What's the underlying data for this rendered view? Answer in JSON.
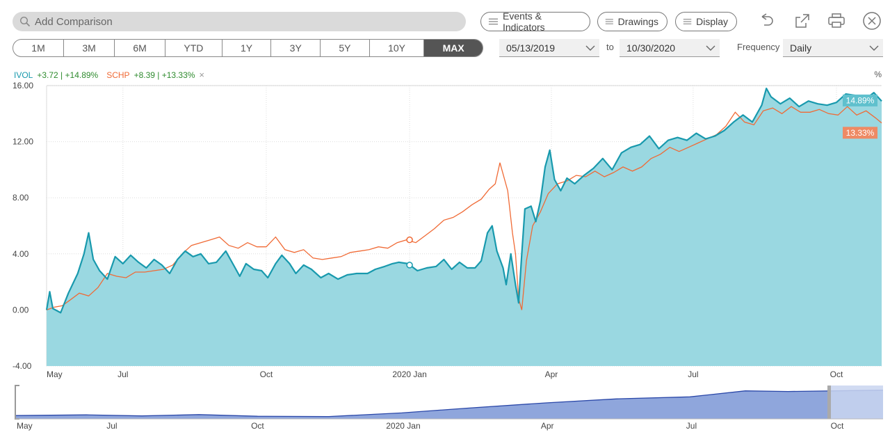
{
  "search": {
    "placeholder": "Add Comparison"
  },
  "toolbar": {
    "events_label": "Events & Indicators",
    "drawings_label": "Drawings",
    "display_label": "Display"
  },
  "ranges": [
    "1M",
    "3M",
    "6M",
    "YTD",
    "1Y",
    "3Y",
    "5Y",
    "10Y",
    "MAX"
  ],
  "range_selected": "MAX",
  "dates": {
    "from": "05/13/2019",
    "to_label": "to",
    "to": "10/30/2020"
  },
  "frequency": {
    "label": "Frequency",
    "value": "Daily"
  },
  "legend": {
    "ivol_name": "IVOL",
    "ivol_stats": "+3.72 | +14.89%",
    "schp_name": "SCHP",
    "schp_stats": "+8.39 | +13.33%",
    "close_glyph": "×",
    "unit": "%"
  },
  "colors": {
    "ivol": "#1899ad",
    "ivol_fill": "#9ad8e1",
    "schp": "#f06a35",
    "gain": "#2e8b2e",
    "navigator": "#8fa6dc",
    "navigator_line": "#2a47a8"
  },
  "chart_data": {
    "type": "line",
    "x_start": "2019-05-13",
    "x_end": "2020-10-30",
    "ylim": [
      -4,
      16
    ],
    "yticks": [
      16,
      12,
      8,
      4,
      0,
      -4
    ],
    "ytick_labels": [
      "16.00",
      "12.00",
      "8.00",
      "4.00",
      "0.00",
      "-4.00"
    ],
    "xtick_dates": [
      "2019-05-01",
      "2019-07-01",
      "2019-10-01",
      "2020-01-01",
      "2020-04-01",
      "2020-07-01",
      "2020-10-01"
    ],
    "xtick_labels": [
      "May",
      "Jul",
      "Oct",
      "2020 Jan",
      "Apr",
      "Jul",
      "Oct"
    ],
    "series": [
      {
        "name": "IVOL",
        "end_label": "14.89%",
        "points": [
          [
            "2019-05-13",
            0.0
          ],
          [
            "2019-05-15",
            1.3
          ],
          [
            "2019-05-17",
            0.1
          ],
          [
            "2019-05-22",
            -0.2
          ],
          [
            "2019-05-27",
            1.2
          ],
          [
            "2019-06-02",
            2.6
          ],
          [
            "2019-06-06",
            4.0
          ],
          [
            "2019-06-09",
            5.5
          ],
          [
            "2019-06-12",
            3.6
          ],
          [
            "2019-06-16",
            2.8
          ],
          [
            "2019-06-21",
            2.2
          ],
          [
            "2019-06-26",
            3.8
          ],
          [
            "2019-07-01",
            3.3
          ],
          [
            "2019-07-06",
            3.9
          ],
          [
            "2019-07-11",
            3.4
          ],
          [
            "2019-07-16",
            3.0
          ],
          [
            "2019-07-21",
            3.6
          ],
          [
            "2019-07-26",
            3.2
          ],
          [
            "2019-07-31",
            2.6
          ],
          [
            "2019-08-05",
            3.6
          ],
          [
            "2019-08-10",
            4.2
          ],
          [
            "2019-08-15",
            3.8
          ],
          [
            "2019-08-20",
            4.0
          ],
          [
            "2019-08-25",
            3.3
          ],
          [
            "2019-08-30",
            3.4
          ],
          [
            "2019-09-05",
            4.2
          ],
          [
            "2019-09-10",
            3.2
          ],
          [
            "2019-09-14",
            2.4
          ],
          [
            "2019-09-18",
            3.3
          ],
          [
            "2019-09-23",
            2.9
          ],
          [
            "2019-09-28",
            2.8
          ],
          [
            "2019-10-02",
            2.3
          ],
          [
            "2019-10-07",
            3.3
          ],
          [
            "2019-10-11",
            3.9
          ],
          [
            "2019-10-16",
            3.3
          ],
          [
            "2019-10-20",
            2.6
          ],
          [
            "2019-10-25",
            3.2
          ],
          [
            "2019-10-30",
            2.9
          ],
          [
            "2019-11-05",
            2.3
          ],
          [
            "2019-11-10",
            2.6
          ],
          [
            "2019-11-16",
            2.2
          ],
          [
            "2019-11-22",
            2.5
          ],
          [
            "2019-11-28",
            2.6
          ],
          [
            "2019-12-05",
            2.6
          ],
          [
            "2019-12-10",
            2.9
          ],
          [
            "2019-12-16",
            3.1
          ],
          [
            "2019-12-21",
            3.3
          ],
          [
            "2019-12-25",
            3.4
          ],
          [
            "2019-12-31",
            3.3
          ],
          [
            "2020-01-06",
            2.8
          ],
          [
            "2020-01-12",
            3.0
          ],
          [
            "2020-01-18",
            3.1
          ],
          [
            "2020-01-23",
            3.6
          ],
          [
            "2020-01-28",
            2.9
          ],
          [
            "2020-02-02",
            3.4
          ],
          [
            "2020-02-07",
            3.0
          ],
          [
            "2020-02-12",
            3.0
          ],
          [
            "2020-02-16",
            3.5
          ],
          [
            "2020-02-20",
            5.5
          ],
          [
            "2020-02-23",
            6.0
          ],
          [
            "2020-02-26",
            4.2
          ],
          [
            "2020-03-01",
            3.0
          ],
          [
            "2020-03-03",
            1.8
          ],
          [
            "2020-03-06",
            4.0
          ],
          [
            "2020-03-09",
            1.8
          ],
          [
            "2020-03-11",
            0.5
          ],
          [
            "2020-03-13",
            4.0
          ],
          [
            "2020-03-15",
            7.2
          ],
          [
            "2020-03-19",
            7.4
          ],
          [
            "2020-03-22",
            6.3
          ],
          [
            "2020-03-25",
            7.8
          ],
          [
            "2020-03-28",
            10.2
          ],
          [
            "2020-03-31",
            11.4
          ],
          [
            "2020-04-03",
            9.3
          ],
          [
            "2020-04-07",
            8.5
          ],
          [
            "2020-04-11",
            9.4
          ],
          [
            "2020-04-16",
            9.0
          ],
          [
            "2020-04-22",
            9.6
          ],
          [
            "2020-04-28",
            10.1
          ],
          [
            "2020-05-04",
            10.8
          ],
          [
            "2020-05-10",
            10.0
          ],
          [
            "2020-05-16",
            11.2
          ],
          [
            "2020-05-22",
            11.6
          ],
          [
            "2020-05-28",
            11.8
          ],
          [
            "2020-06-03",
            12.4
          ],
          [
            "2020-06-09",
            11.5
          ],
          [
            "2020-06-15",
            12.1
          ],
          [
            "2020-06-21",
            12.3
          ],
          [
            "2020-06-27",
            12.1
          ],
          [
            "2020-07-03",
            12.6
          ],
          [
            "2020-07-09",
            12.2
          ],
          [
            "2020-07-15",
            12.4
          ],
          [
            "2020-07-21",
            12.8
          ],
          [
            "2020-07-27",
            13.4
          ],
          [
            "2020-08-02",
            13.9
          ],
          [
            "2020-08-08",
            13.4
          ],
          [
            "2020-08-14",
            14.6
          ],
          [
            "2020-08-17",
            15.8
          ],
          [
            "2020-08-20",
            15.2
          ],
          [
            "2020-08-26",
            14.7
          ],
          [
            "2020-09-01",
            15.1
          ],
          [
            "2020-09-07",
            14.5
          ],
          [
            "2020-09-13",
            14.9
          ],
          [
            "2020-09-19",
            14.7
          ],
          [
            "2020-09-25",
            14.6
          ],
          [
            "2020-10-01",
            14.8
          ],
          [
            "2020-10-07",
            15.4
          ],
          [
            "2020-10-13",
            15.3
          ],
          [
            "2020-10-19",
            15.0
          ],
          [
            "2020-10-25",
            15.5
          ],
          [
            "2020-10-30",
            14.89
          ]
        ]
      },
      {
        "name": "SCHP",
        "end_label": "13.33%",
        "points": [
          [
            "2019-05-13",
            0.0
          ],
          [
            "2019-05-18",
            0.2
          ],
          [
            "2019-05-23",
            0.3
          ],
          [
            "2019-05-28",
            0.7
          ],
          [
            "2019-06-03",
            1.2
          ],
          [
            "2019-06-09",
            1.0
          ],
          [
            "2019-06-15",
            1.6
          ],
          [
            "2019-06-21",
            2.6
          ],
          [
            "2019-06-27",
            2.4
          ],
          [
            "2019-07-03",
            2.3
          ],
          [
            "2019-07-09",
            2.7
          ],
          [
            "2019-07-15",
            2.7
          ],
          [
            "2019-07-21",
            2.8
          ],
          [
            "2019-07-27",
            2.9
          ],
          [
            "2019-08-02",
            3.2
          ],
          [
            "2019-08-08",
            4.0
          ],
          [
            "2019-08-14",
            4.6
          ],
          [
            "2019-08-20",
            4.8
          ],
          [
            "2019-08-26",
            5.0
          ],
          [
            "2019-09-01",
            5.2
          ],
          [
            "2019-09-07",
            4.6
          ],
          [
            "2019-09-13",
            4.4
          ],
          [
            "2019-09-19",
            4.8
          ],
          [
            "2019-09-25",
            4.5
          ],
          [
            "2019-10-01",
            4.5
          ],
          [
            "2019-10-07",
            5.2
          ],
          [
            "2019-10-13",
            4.3
          ],
          [
            "2019-10-19",
            4.1
          ],
          [
            "2019-10-25",
            4.3
          ],
          [
            "2019-10-31",
            3.7
          ],
          [
            "2019-11-06",
            3.6
          ],
          [
            "2019-11-12",
            3.7
          ],
          [
            "2019-11-18",
            3.8
          ],
          [
            "2019-11-24",
            4.1
          ],
          [
            "2019-11-30",
            4.2
          ],
          [
            "2019-12-06",
            4.3
          ],
          [
            "2019-12-12",
            4.5
          ],
          [
            "2019-12-18",
            4.4
          ],
          [
            "2019-12-24",
            4.8
          ],
          [
            "2019-12-30",
            5.0
          ],
          [
            "2020-01-05",
            4.8
          ],
          [
            "2020-01-11",
            5.3
          ],
          [
            "2020-01-17",
            5.8
          ],
          [
            "2020-01-23",
            6.4
          ],
          [
            "2020-01-29",
            6.6
          ],
          [
            "2020-02-04",
            7.0
          ],
          [
            "2020-02-10",
            7.5
          ],
          [
            "2020-02-16",
            7.9
          ],
          [
            "2020-02-21",
            8.6
          ],
          [
            "2020-02-25",
            9.0
          ],
          [
            "2020-02-28",
            10.5
          ],
          [
            "2020-03-04",
            8.5
          ],
          [
            "2020-03-07",
            5.5
          ],
          [
            "2020-03-09",
            4.0
          ],
          [
            "2020-03-11",
            0.8
          ],
          [
            "2020-03-13",
            0.0
          ],
          [
            "2020-03-16",
            3.5
          ],
          [
            "2020-03-20",
            6.0
          ],
          [
            "2020-03-25",
            7.0
          ],
          [
            "2020-03-30",
            8.3
          ],
          [
            "2020-04-05",
            9.0
          ],
          [
            "2020-04-11",
            9.2
          ],
          [
            "2020-04-17",
            9.6
          ],
          [
            "2020-04-23",
            9.5
          ],
          [
            "2020-04-29",
            9.9
          ],
          [
            "2020-05-05",
            9.5
          ],
          [
            "2020-05-11",
            9.8
          ],
          [
            "2020-05-17",
            10.2
          ],
          [
            "2020-05-23",
            9.9
          ],
          [
            "2020-05-29",
            10.2
          ],
          [
            "2020-06-04",
            10.8
          ],
          [
            "2020-06-10",
            11.1
          ],
          [
            "2020-06-16",
            11.6
          ],
          [
            "2020-06-22",
            11.3
          ],
          [
            "2020-06-28",
            11.6
          ],
          [
            "2020-07-04",
            11.9
          ],
          [
            "2020-07-10",
            12.2
          ],
          [
            "2020-07-16",
            12.5
          ],
          [
            "2020-07-22",
            13.1
          ],
          [
            "2020-07-28",
            14.1
          ],
          [
            "2020-08-03",
            13.4
          ],
          [
            "2020-08-09",
            13.2
          ],
          [
            "2020-08-15",
            14.2
          ],
          [
            "2020-08-21",
            14.4
          ],
          [
            "2020-08-27",
            14.0
          ],
          [
            "2020-09-02",
            14.5
          ],
          [
            "2020-09-08",
            14.1
          ],
          [
            "2020-09-14",
            14.1
          ],
          [
            "2020-09-20",
            14.3
          ],
          [
            "2020-09-26",
            14.0
          ],
          [
            "2020-10-02",
            13.9
          ],
          [
            "2020-10-08",
            14.5
          ],
          [
            "2020-10-14",
            13.9
          ],
          [
            "2020-10-20",
            14.2
          ],
          [
            "2020-10-26",
            13.7
          ],
          [
            "2020-10-30",
            13.33
          ]
        ]
      }
    ],
    "markers": [
      {
        "series": "IVOL",
        "date": "2020-01-01",
        "value": 3.2
      },
      {
        "series": "SCHP",
        "date": "2020-01-01",
        "value": 5.0
      }
    ],
    "navigator": {
      "xtick_labels": [
        "May",
        "Jul",
        "Oct",
        "2020 Jan",
        "Apr",
        "Jul",
        "Oct"
      ],
      "points": [
        [
          "2019-05-01",
          0.5
        ],
        [
          "2019-06-15",
          0.6
        ],
        [
          "2019-07-20",
          0.45
        ],
        [
          "2019-08-25",
          0.65
        ],
        [
          "2019-10-01",
          0.4
        ],
        [
          "2019-11-15",
          0.35
        ],
        [
          "2019-12-31",
          0.9
        ],
        [
          "2020-02-10",
          1.6
        ],
        [
          "2020-03-31",
          2.4
        ],
        [
          "2020-05-15",
          3.0
        ],
        [
          "2020-06-30",
          3.3
        ],
        [
          "2020-08-04",
          4.2
        ],
        [
          "2020-08-31",
          4.1
        ],
        [
          "2020-10-30",
          4.3
        ]
      ]
    }
  }
}
